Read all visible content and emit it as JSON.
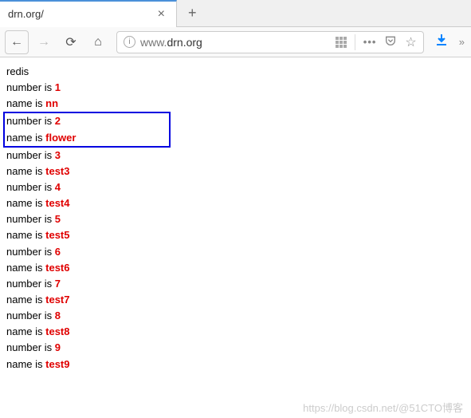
{
  "browser": {
    "tab_title": "drn.org/",
    "new_tab_symbol": "+",
    "close_tab_symbol": "×",
    "url_prefix": "www.",
    "url_domain": "drn.org",
    "dots": "•••",
    "star": "☆",
    "download": "⤓",
    "back": "←",
    "forward": "→",
    "reload": "⟳",
    "home": "⌂",
    "overflow": "»"
  },
  "page": {
    "header": "redis",
    "rows": [
      {
        "number": "1",
        "name": "nn"
      },
      {
        "number": "2",
        "name": "flower"
      },
      {
        "number": "3",
        "name": "test3"
      },
      {
        "number": "4",
        "name": "test4"
      },
      {
        "number": "5",
        "name": "test5"
      },
      {
        "number": "6",
        "name": "test6"
      },
      {
        "number": "7",
        "name": "test7"
      },
      {
        "number": "8",
        "name": "test8"
      },
      {
        "number": "9",
        "name": "test9"
      }
    ],
    "number_label": "number is ",
    "name_label": "name is "
  },
  "watermark": "https://blog.csdn.net/@51CTO博客"
}
